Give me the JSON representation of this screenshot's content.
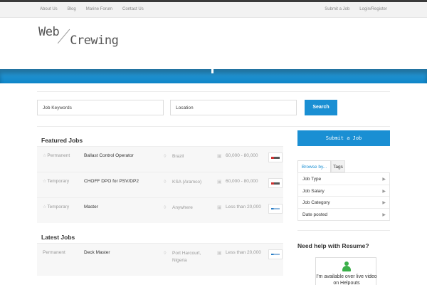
{
  "topnav": {
    "left": [
      "About Us",
      "Blog",
      "Marine Forum",
      "Contact Us"
    ],
    "right": [
      "Submit a Job",
      "Login/Register"
    ]
  },
  "logo": {
    "line1": "Web",
    "line2": "Crewing"
  },
  "search": {
    "keywords_placeholder": "Job Keywords",
    "location_placeholder": "Location",
    "button": "Search"
  },
  "featured": {
    "title": "Featured Jobs",
    "rows": [
      {
        "type": "Permanent",
        "title": "Ballast Control Operator",
        "location": "Brazil",
        "salary": "60,000 - 80,000"
      },
      {
        "type": "Temporary",
        "title": "CHOFF DPO for PSV/DP2",
        "location": "KSA (Aramco)",
        "salary": "60,000 - 80,000"
      },
      {
        "type": "Temporary",
        "title": "Master",
        "location": "Anywhere",
        "salary": "Less than 20,000"
      }
    ]
  },
  "latest": {
    "title": "Latest Jobs",
    "rows": [
      {
        "type": "Permanent",
        "title": "Deck Master",
        "location": "Port Harcourt, Nigeria",
        "salary": "Less than 20,000"
      }
    ]
  },
  "sidebar": {
    "submit_button": "Submit a Job",
    "tabs": [
      "Browse by...",
      "Tags"
    ],
    "browse_items": [
      "Job Type",
      "Job Salary",
      "Job Category",
      "Date posted"
    ],
    "help_title": "Need help with Resume?",
    "helpouts_text": "I'm available over live video on Helpouts"
  },
  "colors": {
    "accent": "#1a8fd3",
    "banner": "#0e85c8",
    "helpouts_green": "#3bb04a"
  }
}
